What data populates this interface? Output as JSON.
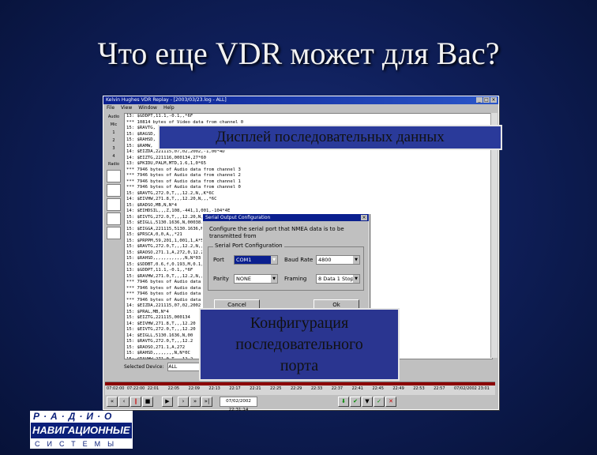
{
  "slide": {
    "title": "Что еще VDR может для Вас?"
  },
  "window": {
    "title": "Kelvin Hughes VDR Replay - [2003/03/23.log - ALL]",
    "menu": [
      "File",
      "View",
      "Window",
      "Help"
    ],
    "left_panel": [
      "Audio",
      "Mic",
      "1",
      "2",
      "3",
      "4",
      "Radio"
    ],
    "log_lines": [
      "13: $GDDPT,11.1,-0.1,,*6F",
      "*** 10814 bytes of Video data from channel 0",
      "15: $RAVTG,",
      "15: $RAGSD,",
      "15: $RAHSD,",
      "15: $RAMW,",
      "14: $EIZDA,221115,07,02,2002,-1,00*4D",
      "14: $EIZTG,221116,000134,27*60",
      "13: $PKIDU,PALM,MTD,1.6,1,0*65",
      "*** 7946 bytes of Audio data from channel 3",
      "*** 7946 bytes of Audio data from channel 2",
      "*** 7946 bytes of Audio data from channel 1",
      "*** 7946 bytes of Audio data from channel 0",
      "15: $RAVTG,272.0,T,,,12.2,N,,K*6C",
      "14: $EIVHW,271.8,T,,,12.20,N,,,*6C",
      "15: $RADSO,MB,N,N*4",
      "14: $EIHDSIL,,,Z,108,-441,1,001,-104*4E",
      "15: $EIVTG,272.0,T,,,12.20,N,,,*6A",
      "15: $EIGLL,5130.1636,N,00038.",
      "15: $EIGGA,221115,5130.1636,N",
      "15: $PRSCA,0,0,A,,*21",
      "15: $PRPPM,59,201,1,001,1,A*50",
      "15: $RAVTG,272.0,T,,,12.2,N,,K*",
      "15: $RAOSO,271.1,A,272,0,12.2,N",
      "15: $RAHSD,,,,,,,,,,,,N,N*03",
      "15: $SDDBT,0.6,f,0.193,M,0.1,F*",
      "13: $GDDPT,11.1,-0.1,,*6F",
      "15: $RAVHW,271.0,T,,,12.2,N,,K*",
      "*** 7946 bytes of Audio data fro",
      "*** 7946 bytes of Audio data fro",
      "*** 7946 bytes of Audio data fro",
      "*** 7946 bytes of Audio data fro",
      "14: $EIZDA,221115,07,02,2002",
      "15: $PRAL,MB,N*4",
      "15: $EIZTG,221115,000134",
      "14: $EIVHW,271.8,T,,,12.20",
      "15: $EIVTG,272.0,T,,,12.20",
      "14: $EIGLL,5130.1636,N,00",
      "15: $RAVTG,272.0,T,,,12.2",
      "15: $RAOSO,271.1,A,272",
      "15: $RAHSD,,,,,,,,N,N*0C",
      "15: $RAVHW,271.0,T,,,12.2"
    ],
    "selected_device_label": "Selected Device:",
    "selected_device_value": "ALL",
    "timeline": [
      "07:02:00",
      "07:22:00",
      "22:01",
      "22:05",
      "22:09",
      "22:13",
      "22:17",
      "22:21",
      "22:25",
      "22:29",
      "22:33",
      "22:37",
      "22:41",
      "22:45",
      "22:49",
      "22:53",
      "22:57",
      "07/02/2002 23:01"
    ],
    "current_time": "07/02/2002 22:31:14"
  },
  "dialog": {
    "title": "Serial Output Configuration",
    "description": "Configure the serial port that NMEA data is to be transmitted from",
    "group_label": "Serial Port Configuration",
    "port_label": "Port",
    "port_value": "COM1",
    "baud_label": "Baud Rate",
    "baud_value": "4800",
    "parity_label": "Parity",
    "parity_value": "NONE",
    "framing_label": "Framing",
    "framing_value": "8 Data 1 Stop",
    "cancel_label": "Cancel",
    "ok_label": "Ok"
  },
  "callouts": {
    "sequential_display": "Дисплей последовательных данных",
    "serial_config_line1": "Конфигурация",
    "serial_config_line2": "последовательного",
    "serial_config_line3": "порта"
  },
  "logo": {
    "top": "Р·А·Д·И·О",
    "middle": "НАВИГАЦИОННЫЕ",
    "bottom": "СИСТЕМЫ"
  }
}
